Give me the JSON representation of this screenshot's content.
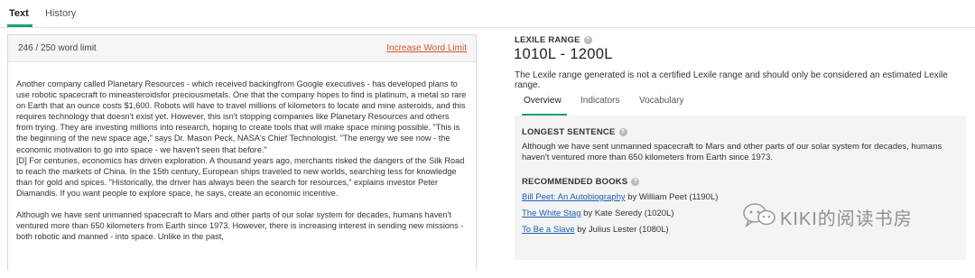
{
  "tabs": {
    "text": "Text",
    "history": "History"
  },
  "editor": {
    "word_limit": "246 / 250 word limit",
    "increase_link": "Increase Word Limit",
    "paragraphs": [
      "Another company called Planetary Resources - which received backingfrom Google executives - has developed plans to use robotic spacecraft to mineasteroidsfor preciousmetals. One that the company hopes to find is platinum, a metal so rare on Earth that an ounce costs $1,600. Robots will have to travel millions of kilometers to locate and mine asteroids, and this requires technology that doesn't exist yet. However, this isn't stopping companies like Planetary Resources and others from trying. They are investing millions into research, hoping to create tools that will make space mining possible. \"This is the beginning of the new space age,\" says Dr. Mason Peck, NASA's Chief Technologist. \"The energy we see now - the economic motivation to go into space - we haven't seen that before.\"\n[D] For centuries, economics has driven exploration. A thousand years ago, merchants risked the dangers of the Silk Road to reach the markets of China. In the 15th century, European ships traveled to new worlds, searching less for knowledge than for gold and spices. \"Historically, the driver has always been the search for resources,\" explains investor Peter Diamandis. If you want people to explore space, he says, create an economic incentive.",
      "Although we have sent unmanned spacecraft to Mars and other parts of our solar system for decades, humans haven't ventured more than 650 kilometers from Earth since 1973. However, there is increasing interest in sending new missions - both robotic and manned - into space. Unlike in the past,"
    ]
  },
  "lexile": {
    "label": "LEXILE RANGE",
    "value": "1010L - 1200L",
    "note": "The Lexile range generated is not a certified Lexile range and should only be considered an estimated Lexile range."
  },
  "subtabs": {
    "overview": "Overview",
    "indicators": "Indicators",
    "vocabulary": "Vocabulary"
  },
  "overview": {
    "longest_title": "LONGEST SENTENCE",
    "longest_sentence": "Although we have sent unmanned spacecraft to Mars and other parts of our solar system for decades, humans haven't ventured more than 650 kilometers from Earth since 1973.",
    "books_title": "RECOMMENDED BOOKS",
    "books": [
      {
        "title": "Bill Peet: An Autobiography",
        "rest": " by William Peet (1190L)"
      },
      {
        "title": "The White Stag",
        "rest": " by Kate Seredy (1020L)"
      },
      {
        "title": "To Be a Slave",
        "rest": " by Julius Lester (1080L)"
      }
    ]
  },
  "info_glyph": "?",
  "watermark": "KIKI的阅读书房",
  "colors": {
    "accent": "#1a9f7a",
    "link": "#1a5fb4",
    "increase_link": "#d5582a"
  }
}
